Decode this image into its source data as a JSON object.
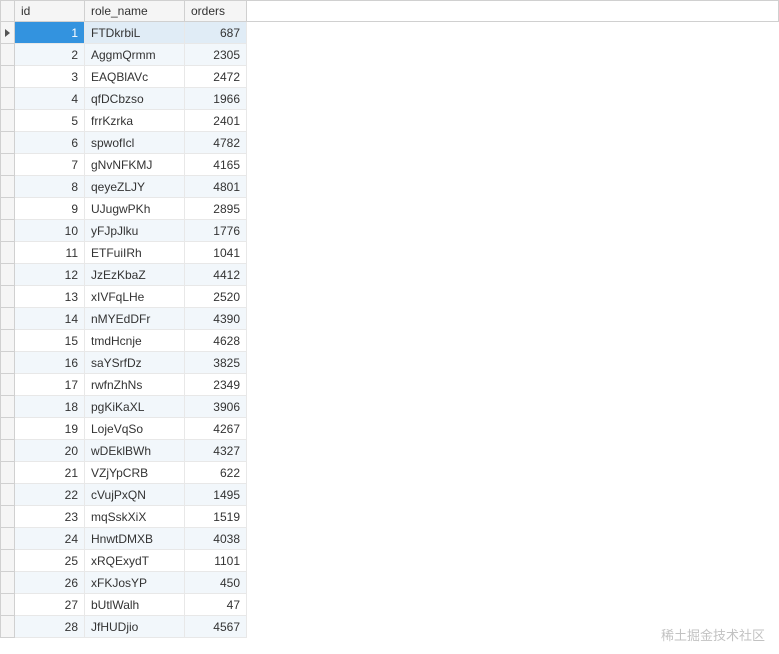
{
  "columns": {
    "id": "id",
    "role_name": "role_name",
    "orders": "orders"
  },
  "rows": [
    {
      "id": "1",
      "role_name": "FTDkrbiL",
      "orders": "687",
      "selected": true,
      "pointer": true
    },
    {
      "id": "2",
      "role_name": "AggmQrmm",
      "orders": "2305"
    },
    {
      "id": "3",
      "role_name": "EAQBlAVc",
      "orders": "2472"
    },
    {
      "id": "4",
      "role_name": "qfDCbzso",
      "orders": "1966"
    },
    {
      "id": "5",
      "role_name": "frrKzrka",
      "orders": "2401"
    },
    {
      "id": "6",
      "role_name": "spwofIcl",
      "orders": "4782"
    },
    {
      "id": "7",
      "role_name": "gNvNFKMJ",
      "orders": "4165"
    },
    {
      "id": "8",
      "role_name": "qeyeZLJY",
      "orders": "4801"
    },
    {
      "id": "9",
      "role_name": "UJugwPKh",
      "orders": "2895"
    },
    {
      "id": "10",
      "role_name": "yFJpJlku",
      "orders": "1776"
    },
    {
      "id": "11",
      "role_name": "ETFuiIRh",
      "orders": "1041"
    },
    {
      "id": "12",
      "role_name": "JzEzKbaZ",
      "orders": "4412"
    },
    {
      "id": "13",
      "role_name": "xIVFqLHe",
      "orders": "2520"
    },
    {
      "id": "14",
      "role_name": "nMYEdDFr",
      "orders": "4390"
    },
    {
      "id": "15",
      "role_name": "tmdHcnje",
      "orders": "4628"
    },
    {
      "id": "16",
      "role_name": "saYSrfDz",
      "orders": "3825"
    },
    {
      "id": "17",
      "role_name": "rwfnZhNs",
      "orders": "2349"
    },
    {
      "id": "18",
      "role_name": "pgKiKaXL",
      "orders": "3906"
    },
    {
      "id": "19",
      "role_name": "LojeVqSo",
      "orders": "4267"
    },
    {
      "id": "20",
      "role_name": "wDEklBWh",
      "orders": "4327"
    },
    {
      "id": "21",
      "role_name": "VZjYpCRB",
      "orders": "622"
    },
    {
      "id": "22",
      "role_name": "cVujPxQN",
      "orders": "1495"
    },
    {
      "id": "23",
      "role_name": "mqSskXiX",
      "orders": "1519"
    },
    {
      "id": "24",
      "role_name": "HnwtDMXB",
      "orders": "4038"
    },
    {
      "id": "25",
      "role_name": "xRQExydT",
      "orders": "1101"
    },
    {
      "id": "26",
      "role_name": "xFKJosYP",
      "orders": "450"
    },
    {
      "id": "27",
      "role_name": "bUtlWalh",
      "orders": "47"
    },
    {
      "id": "28",
      "role_name": "JfHUDjio",
      "orders": "4567"
    }
  ],
  "watermark": "稀土掘金技术社区"
}
